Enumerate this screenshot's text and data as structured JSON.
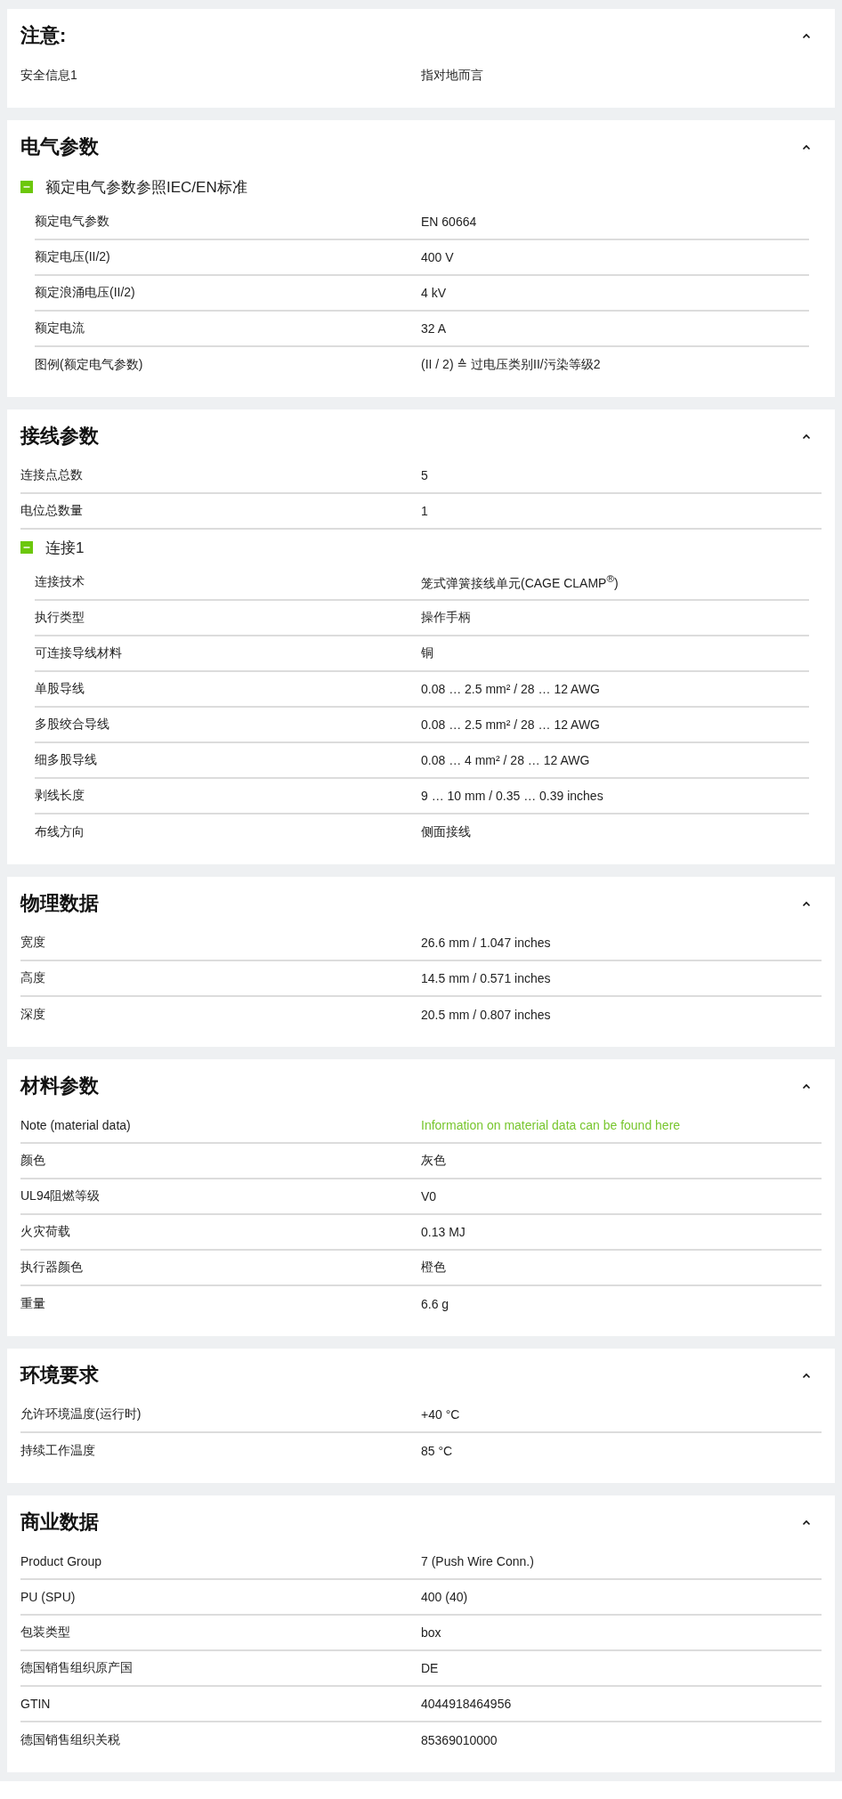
{
  "sections": [
    {
      "title": "注意:",
      "expanded": true,
      "items": [
        {
          "kind": "row",
          "label": "安全信息1",
          "value": "指对地而言"
        }
      ]
    },
    {
      "title": "电气参数",
      "expanded": true,
      "items": [
        {
          "kind": "group",
          "label": "额定电气参数参照IEC/EN标准",
          "expanded": true,
          "children": [
            {
              "kind": "row",
              "label": "额定电气参数",
              "value": "EN 60664"
            },
            {
              "kind": "row",
              "label": "额定电压(II/2)",
              "value": "400 V"
            },
            {
              "kind": "row",
              "label": "额定浪涌电压(II/2)",
              "value": "4 kV"
            },
            {
              "kind": "row",
              "label": "额定电流",
              "value": "32 A"
            },
            {
              "kind": "row",
              "label": "图例(额定电气参数)",
              "value": "(II / 2) ≙ 过电压类别II/污染等级2"
            }
          ]
        }
      ]
    },
    {
      "title": "接线参数",
      "expanded": true,
      "items": [
        {
          "kind": "row",
          "label": "连接点总数",
          "value": "5"
        },
        {
          "kind": "row",
          "label": "电位总数量",
          "value": "1"
        },
        {
          "kind": "group",
          "label": "连接1",
          "expanded": true,
          "children": [
            {
              "kind": "row",
              "label": "连接技术",
              "value": "笼式弹簧接线单元(CAGE CLAMP$^{®}$)"
            },
            {
              "kind": "row",
              "label": "执行类型",
              "value": "操作手柄"
            },
            {
              "kind": "row",
              "label": "可连接导线材料",
              "value": "铜"
            },
            {
              "kind": "row",
              "label": "单股导线",
              "value": "0.08 … 2.5 mm² / 28 … 12 AWG"
            },
            {
              "kind": "row",
              "label": "多股绞合导线",
              "value": "0.08 … 2.5 mm² / 28 … 12 AWG"
            },
            {
              "kind": "row",
              "label": "细多股导线",
              "value": "0.08 … 4 mm² / 28 … 12 AWG"
            },
            {
              "kind": "row",
              "label": "剥线长度",
              "value": "9 … 10 mm / 0.35 … 0.39 inches"
            },
            {
              "kind": "row",
              "label": "布线方向",
              "value": "侧面接线"
            }
          ]
        }
      ]
    },
    {
      "title": "物理数据",
      "expanded": true,
      "items": [
        {
          "kind": "row",
          "label": "宽度",
          "value": "26.6 mm / 1.047 inches"
        },
        {
          "kind": "row",
          "label": "高度",
          "value": "14.5 mm / 0.571 inches"
        },
        {
          "kind": "row",
          "label": "深度",
          "value": "20.5 mm / 0.807 inches"
        }
      ]
    },
    {
      "title": "材料参数",
      "expanded": true,
      "items": [
        {
          "kind": "link",
          "label": "Note (material data)",
          "value": "Information on material data can be found here"
        },
        {
          "kind": "row",
          "label": "颜色",
          "value": "灰色"
        },
        {
          "kind": "row",
          "label": "UL94阻燃等级",
          "value": "V0"
        },
        {
          "kind": "row",
          "label": "火灾荷载",
          "value": "0.13 MJ"
        },
        {
          "kind": "row",
          "label": "执行器颜色",
          "value": "橙色"
        },
        {
          "kind": "row",
          "label": "重量",
          "value": "6.6 g"
        }
      ]
    },
    {
      "title": "环境要求",
      "expanded": true,
      "items": [
        {
          "kind": "row",
          "label": "允许环境温度(运行时)",
          "value": "+40 °C"
        },
        {
          "kind": "row",
          "label": "持续工作温度",
          "value": "85 °C"
        }
      ]
    },
    {
      "title": "商业数据",
      "expanded": true,
      "items": [
        {
          "kind": "row",
          "label": "Product Group",
          "value": "7 (Push Wire Conn.)"
        },
        {
          "kind": "row",
          "label": "PU (SPU)",
          "value": "400 (40)"
        },
        {
          "kind": "row",
          "label": "包装类型",
          "value": "box"
        },
        {
          "kind": "row",
          "label": "德国销售组织原产国",
          "value": "DE"
        },
        {
          "kind": "row",
          "label": "GTIN",
          "value": "4044918464956"
        },
        {
          "kind": "row",
          "label": "德国销售组织关税",
          "value": "85369010000"
        }
      ]
    }
  ]
}
